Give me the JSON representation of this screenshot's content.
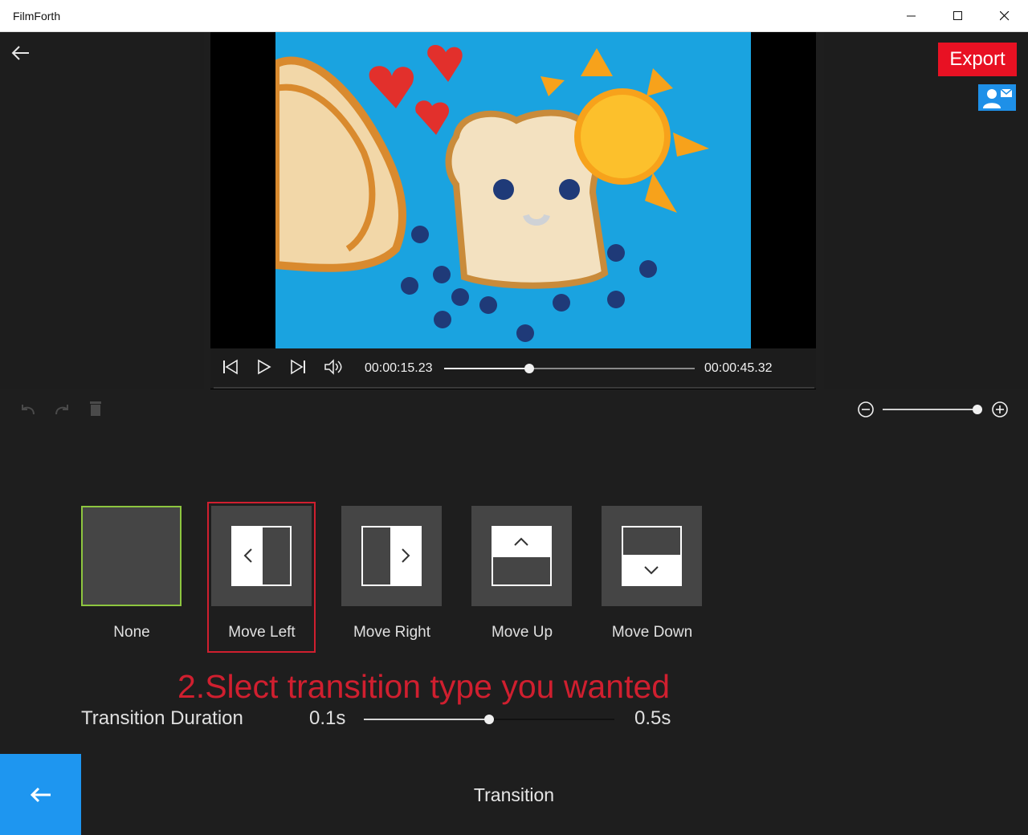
{
  "app": {
    "title": "FilmForth"
  },
  "player": {
    "current_time": "00:00:15.23",
    "total_time": "00:00:45.32",
    "progress": 0.34
  },
  "toolbar": {
    "export_label": "Export"
  },
  "zoom": {
    "level": 1.0
  },
  "transitions": {
    "items": [
      {
        "label": "None"
      },
      {
        "label": "Move Left"
      },
      {
        "label": "Move Right"
      },
      {
        "label": "Move Up"
      },
      {
        "label": "Move Down"
      }
    ],
    "selected": "Move Left",
    "annotation": "2.Slect transition type you wanted"
  },
  "duration": {
    "label": "Transition Duration",
    "min_label": "0.1s",
    "max_label": "0.5s",
    "value_fraction": 0.5
  },
  "footer": {
    "title": "Transition"
  },
  "colors": {
    "export": "#e81123",
    "accent_blue": "#1e96f0",
    "annotation_red": "#d01f2f",
    "none_tile_border": "#8dc63f",
    "video_background": "#1aa3e0"
  }
}
